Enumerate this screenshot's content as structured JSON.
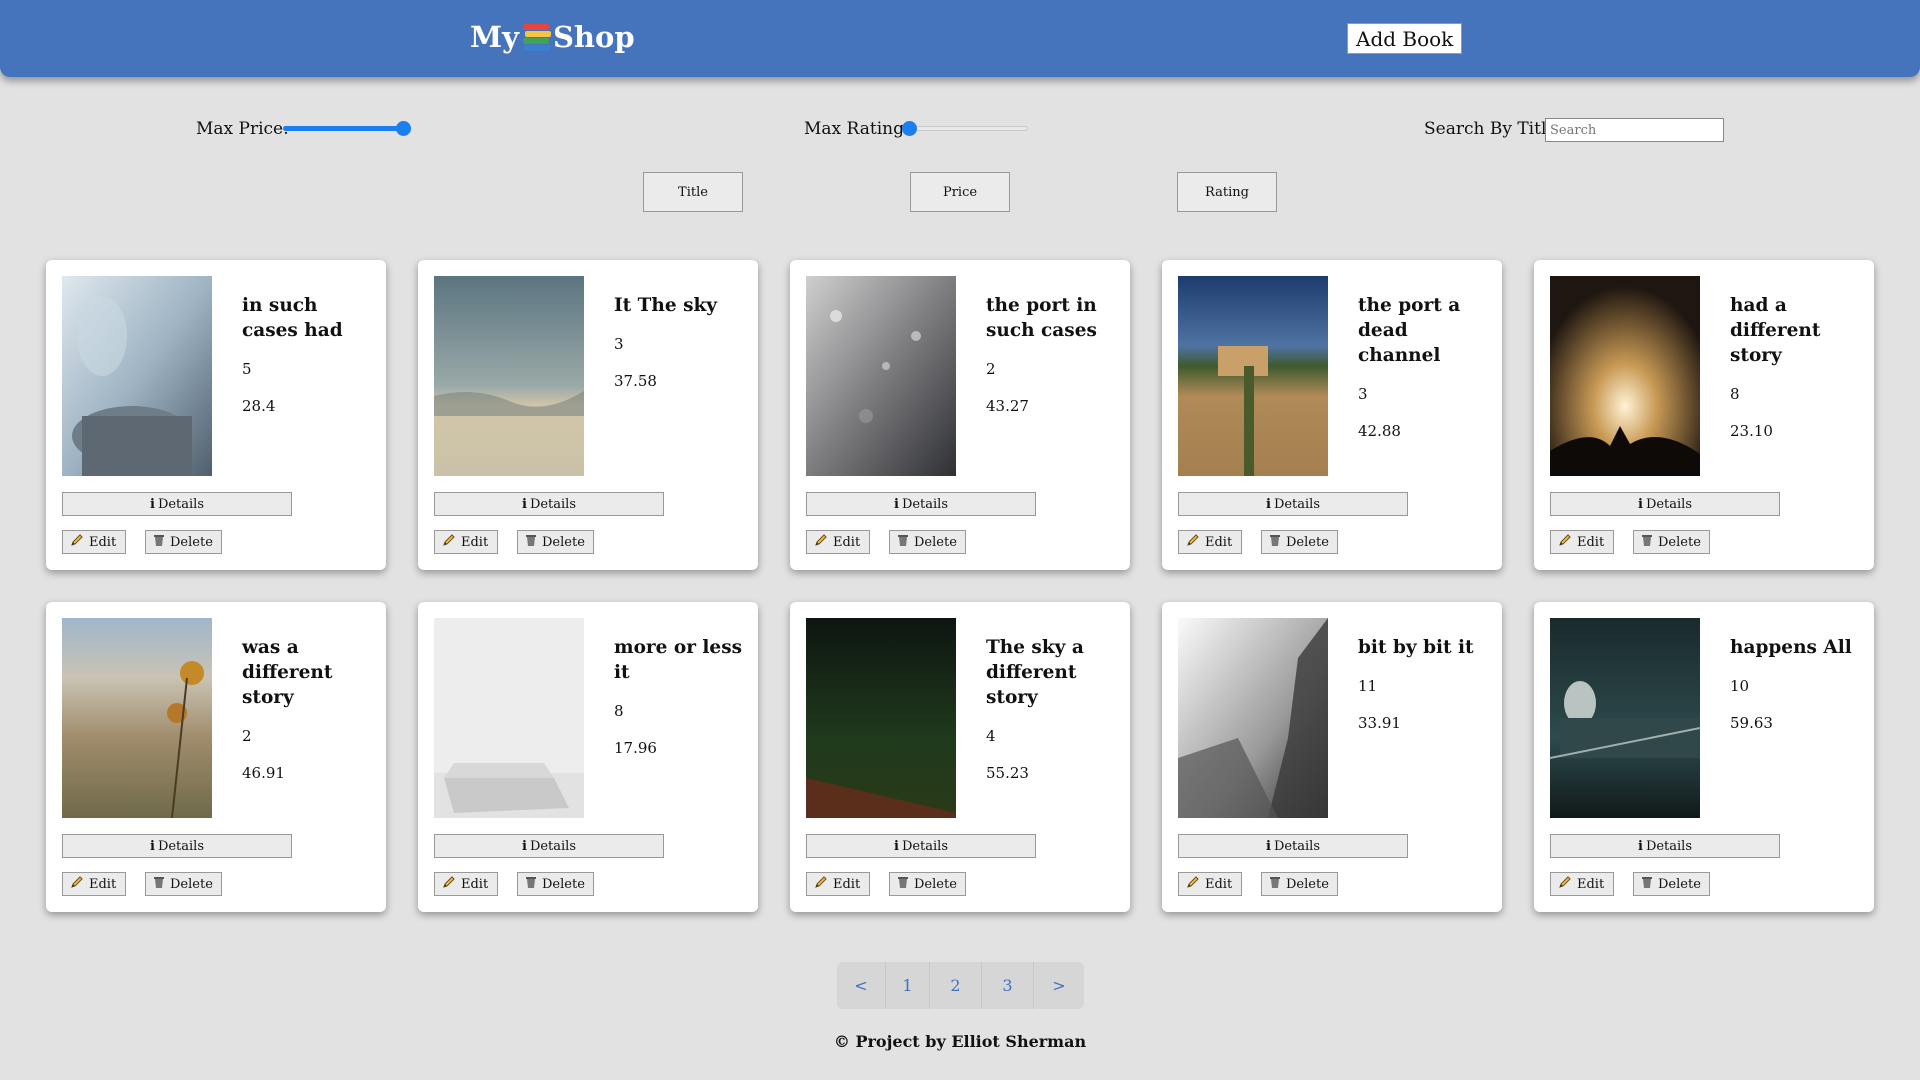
{
  "header": {
    "logo_prefix": "My",
    "logo_icon": "books-icon",
    "logo_suffix": "Shop",
    "add_book_label": "Add Book",
    "color": "#4574bd"
  },
  "filters": {
    "max_price_label": "Max Price:",
    "max_price_value": 1.0,
    "max_rating_label": "Max Rating:",
    "max_rating_value": 0.0,
    "search_label": "Search By Title:",
    "search_placeholder": "Search"
  },
  "sort": {
    "title": "Title",
    "price": "Price",
    "rating": "Rating"
  },
  "card_labels": {
    "details": "Details",
    "edit": "Edit",
    "delete": "Delete"
  },
  "books": [
    {
      "title": "in such cases had",
      "rating": "5",
      "price": "28.4"
    },
    {
      "title": "It The sky",
      "rating": "3",
      "price": "37.58"
    },
    {
      "title": "the port in such cases",
      "rating": "2",
      "price": "43.27"
    },
    {
      "title": "the port a dead channel",
      "rating": "3",
      "price": "42.88"
    },
    {
      "title": "had a different story",
      "rating": "8",
      "price": "23.10"
    },
    {
      "title": "was a different story",
      "rating": "2",
      "price": "46.91"
    },
    {
      "title": "more or less it",
      "rating": "8",
      "price": "17.96"
    },
    {
      "title": "The sky a different story",
      "rating": "4",
      "price": "55.23"
    },
    {
      "title": "bit by bit it",
      "rating": "11",
      "price": "33.91"
    },
    {
      "title": "happens All",
      "rating": "10",
      "price": "59.63"
    }
  ],
  "pagination": [
    "<",
    "1",
    "2",
    "3",
    ">"
  ],
  "footer": "© Project by Elliot Sherman",
  "colors": {
    "accent": "#1a7ff0",
    "link": "#3f6fc0",
    "background": "#e2e2e2"
  }
}
